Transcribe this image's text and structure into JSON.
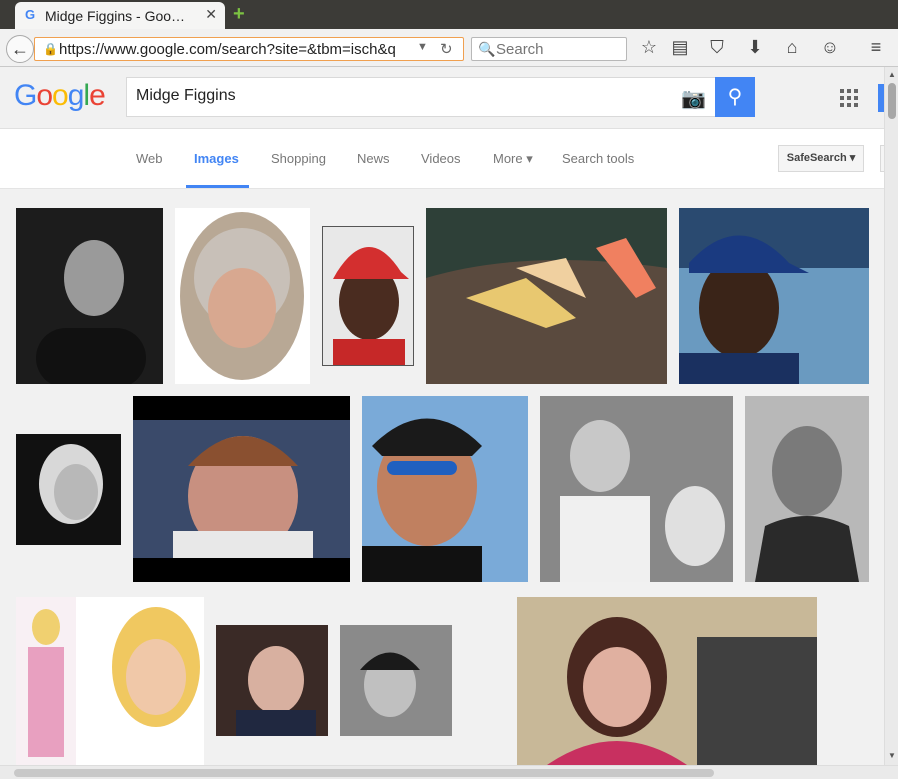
{
  "tab": {
    "title": "Midge Figgins - Goo…",
    "favicon": "G"
  },
  "browser": {
    "url": "https://www.google.com/search?site=&tbm=isch&q",
    "search_placeholder": "Search"
  },
  "google": {
    "logo": [
      "G",
      "o",
      "o",
      "g",
      "l",
      "e"
    ],
    "logo_colors": [
      "#4285f4",
      "#ea4335",
      "#fbbc05",
      "#4285f4",
      "#34a853",
      "#ea4335"
    ],
    "query": "Midge Figgins"
  },
  "nav": {
    "items": [
      "Web",
      "Images",
      "Shopping",
      "News",
      "Videos",
      "More ▾",
      "Search tools"
    ],
    "active": "Images",
    "safesearch": "SafeSearch ▾"
  },
  "results": [
    {
      "name": "man-bald-bw",
      "colors": [
        "#2a2a2a",
        "#8a8a8a"
      ]
    },
    {
      "name": "woman-grey-hair-oval",
      "colors": [
        "#c9b7a5",
        "#a88a78"
      ]
    },
    {
      "name": "baseball-player-red-cap",
      "colors": [
        "#c62828",
        "#3e2723"
      ]
    },
    {
      "name": "dolls-on-rocks",
      "colors": [
        "#3b3530",
        "#d8b060"
      ]
    },
    {
      "name": "baseball-player-blue-cap",
      "colors": [
        "#1a3b80",
        "#5a88b0"
      ]
    },
    {
      "name": "woman-blonde-bw",
      "colors": [
        "#1a1a1a",
        "#d0d0d0"
      ]
    },
    {
      "name": "woman-glasses-stadium",
      "colors": [
        "#3d4a6a",
        "#b08070"
      ]
    },
    {
      "name": "man-sunglasses-cap",
      "colors": [
        "#3a6fa8",
        "#a0c8e8"
      ]
    },
    {
      "name": "woman-with-dog-bw",
      "colors": [
        "#555555",
        "#dddddd"
      ]
    },
    {
      "name": "man-old-photo-bw",
      "colors": [
        "#3a3a3a",
        "#c8c8c8"
      ]
    },
    {
      "name": "barbie-doll",
      "colors": [
        "#e8a0b8",
        "#f0d080"
      ]
    },
    {
      "name": "girl-dark-hair",
      "colors": [
        "#2a1e1a",
        "#c8a090"
      ]
    },
    {
      "name": "woman-short-hair-bw",
      "colors": [
        "#2a2a2a",
        "#a0a0a0"
      ]
    },
    {
      "name": "woman-radio-studio",
      "colors": [
        "#5a3020",
        "#c04060"
      ]
    }
  ]
}
